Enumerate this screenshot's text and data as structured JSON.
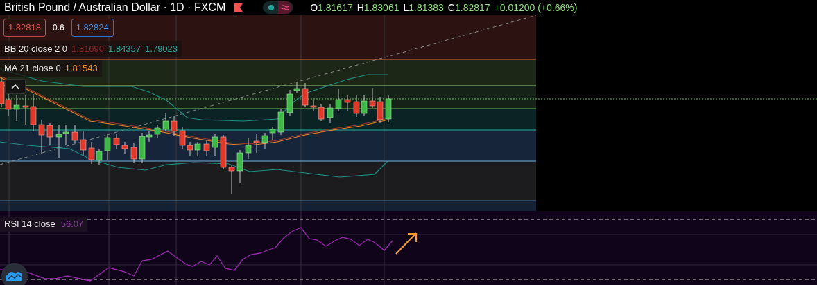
{
  "header": {
    "title": "British Pound / Australian Dollar · 1D · FXCM",
    "ohlc": [
      {
        "label": "O",
        "value": "1.81617"
      },
      {
        "label": "H",
        "value": "1.83061"
      },
      {
        "label": "L",
        "value": "1.81383"
      },
      {
        "label": "C",
        "value": "1.82817"
      }
    ],
    "change": "+0.01200 (+0.66%)",
    "status_on": true
  },
  "price_boxes": {
    "sell": "1.82818",
    "spread": "0.6",
    "buy": "1.82824"
  },
  "indicators": [
    {
      "name": "BB 20 close 2 0",
      "values": [
        {
          "text": "1.81690",
          "color": "#8b2a2a"
        },
        {
          "text": "1.84357",
          "color": "#26a69a"
        },
        {
          "text": "1.79023",
          "color": "#26a69a"
        }
      ]
    },
    {
      "name": "MA 21 close 0",
      "values": [
        {
          "text": "1.81543",
          "color": "#f7931e"
        }
      ]
    }
  ],
  "rsi": {
    "name": "RSI 14 close",
    "value": "56.07"
  }
}
